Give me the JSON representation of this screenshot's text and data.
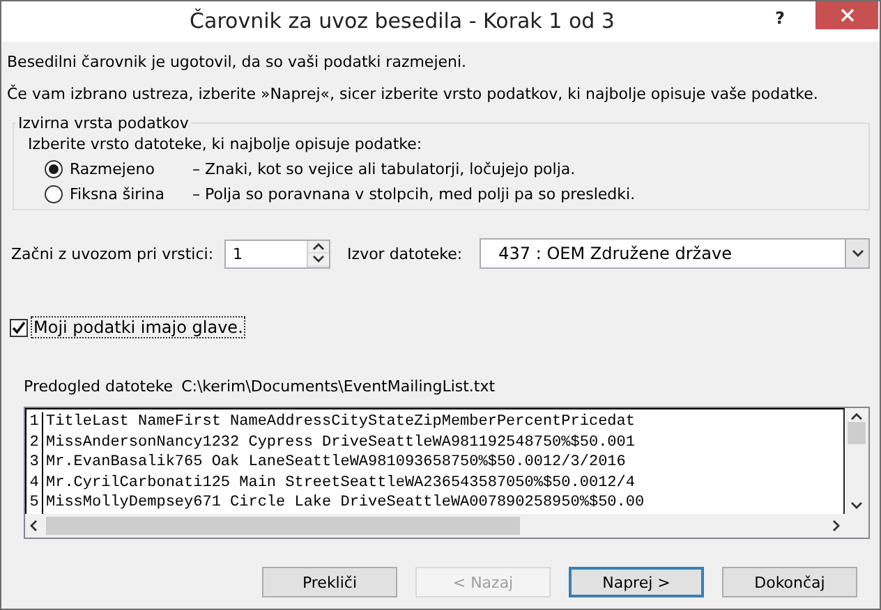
{
  "window": {
    "title": "Čarovnik za uvoz besedila - Korak 1 od 3",
    "help": "?"
  },
  "intro": [
    "Besedilni čarovnik je ugotovil, da so vaši podatki razmejeni.",
    "Če vam izbrano ustreza, izberite »Naprej«, sicer izberite vrsto podatkov, ki najbolje opisuje vaše podatke."
  ],
  "group": {
    "title": "Izvirna vrsta podatkov",
    "prompt": "Izberite vrsto datoteke, ki najbolje opisuje podatke:",
    "options": [
      {
        "label": "Razmejeno",
        "description": "– Znaki, kot so vejice ali tabulatorji, ločujejo polja.",
        "selected": true
      },
      {
        "label": "Fiksna širina",
        "description": "– Polja so poravnana v stolpcih, med polji pa so presledki.",
        "selected": false
      }
    ]
  },
  "start_row": {
    "label": "Začni z uvozom pri vrstici:",
    "value": "1"
  },
  "origin": {
    "label": "Izvor datoteke:",
    "value": "437 : OEM Združene države"
  },
  "headers": {
    "label": "Moji podatki imajo glave.",
    "checked": true
  },
  "preview": {
    "label": "Predogled datoteke",
    "path": "C:\\kerim\\Documents\\EventMailingList.txt",
    "rows": [
      {
        "number": "1",
        "text": "TitleLast NameFirst NameAddressCityStateZipMemberPercentPricedat"
      },
      {
        "number": "2",
        "text": "MissAndersonNancy1232 Cypress DriveSeattleWA981192548750%$50.001"
      },
      {
        "number": "3",
        "text": "Mr.EvanBasalik765 Oak LaneSeattleWA981093658750%$50.0012/3/2016"
      },
      {
        "number": "4",
        "text": "Mr.CyrilCarbonati125 Main StreetSeattleWA236543587050%$50.0012/4"
      },
      {
        "number": "5",
        "text": "MissMollyDempsey671 Circle Lake DriveSeattleWA007890258950%$50.00"
      }
    ]
  },
  "buttons": [
    {
      "label": "Prekliči",
      "disabled": false,
      "default": false
    },
    {
      "label": "< Nazaj",
      "disabled": true,
      "default": false
    },
    {
      "label": "Naprej >",
      "disabled": false,
      "default": true
    },
    {
      "label": "Dokončaj",
      "disabled": false,
      "default": false
    }
  ]
}
